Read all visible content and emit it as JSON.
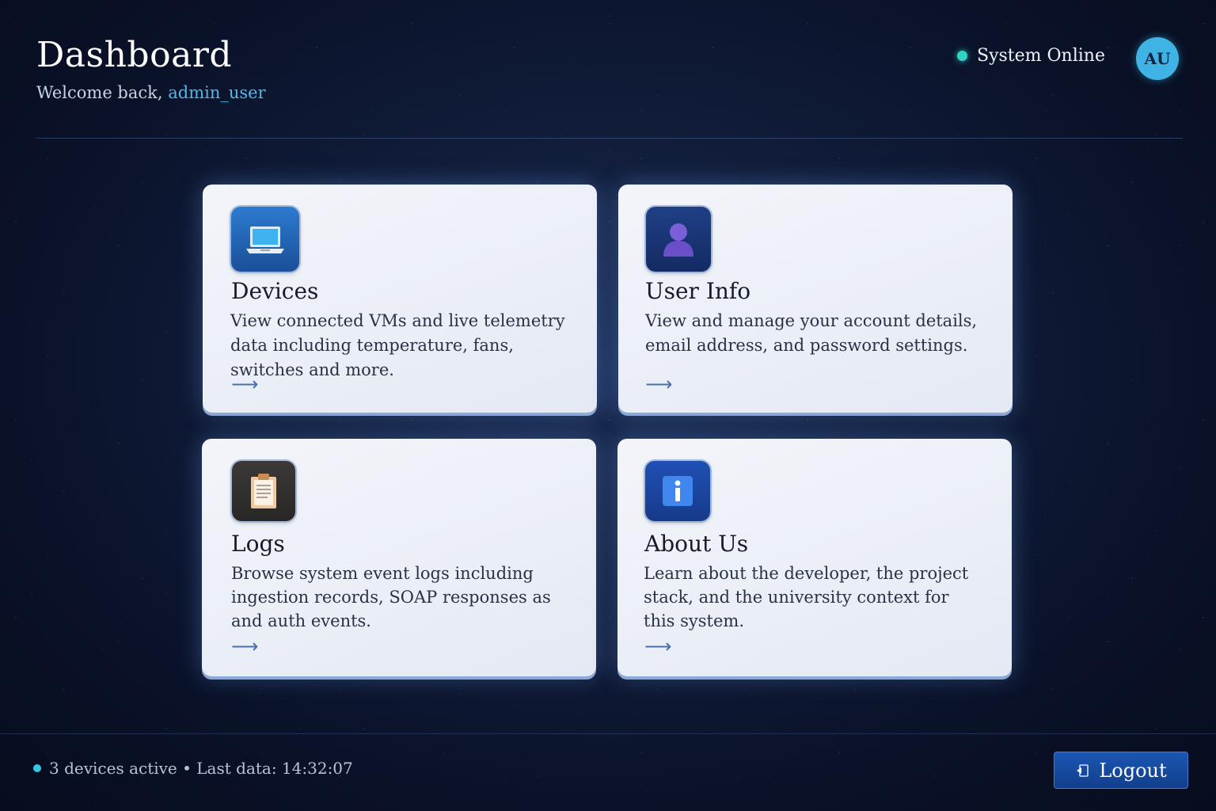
{
  "header": {
    "title": "Dashboard",
    "welcome_prefix": "Welcome back,",
    "username": "admin_user"
  },
  "status": {
    "label": "System Online",
    "color": "#2fd4c4"
  },
  "avatar": {
    "initials": "AU"
  },
  "cards": [
    {
      "id": "devices",
      "icon": "laptop-icon",
      "title": "Devices",
      "description": "View connected VMs and live telemetry data including temperature, fans, switches and more.",
      "arrow": "⟶"
    },
    {
      "id": "user_info",
      "icon": "user-icon",
      "title": "User Info",
      "description": "View and manage your account details, email address, and password settings.",
      "arrow": "⟶"
    },
    {
      "id": "logs",
      "icon": "clipboard-icon",
      "title": "Logs",
      "description": "Browse system event logs including ingestion records, SOAP responses as and auth events.",
      "arrow": "⟶"
    },
    {
      "id": "about",
      "icon": "info-icon",
      "title": "About Us",
      "description": "Learn about the developer, the project stack, and the university context for this system.",
      "arrow": "⟶"
    }
  ],
  "footer": {
    "status_text": "3 devices active • Last data: 14:32:07",
    "logout_label": "Logout"
  },
  "colors": {
    "accent": "#4fb9ea",
    "logout_bg": "#1a56b3"
  }
}
